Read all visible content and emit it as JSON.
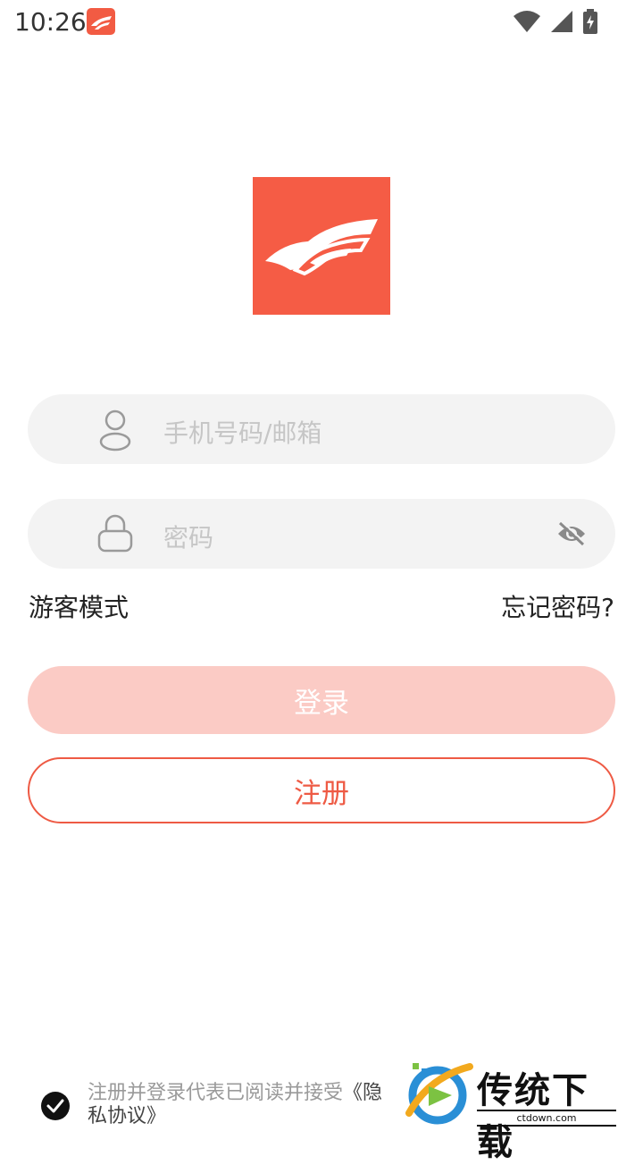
{
  "status_bar": {
    "time": "10:26",
    "icons": [
      "app-notification-icon",
      "wifi-icon",
      "cell-signal-icon",
      "battery-charging-icon"
    ]
  },
  "logo": {
    "icon": "brand-logo-icon",
    "color": "#f55c45"
  },
  "username_field": {
    "icon": "user-icon",
    "placeholder": "手机号码/邮箱",
    "value": ""
  },
  "password_field": {
    "icon": "lock-icon",
    "placeholder": "密码",
    "value": "",
    "toggle_icon": "eye-off-icon"
  },
  "links": {
    "guest_mode": "游客模式",
    "forgot_password": "忘记密码?"
  },
  "buttons": {
    "login": "登录",
    "register": "注册"
  },
  "agreement": {
    "prefix": "注册并登录代表已阅读并接受",
    "policy": "《隐私协议》",
    "checked": true
  },
  "watermark": {
    "title": "传统下载",
    "site": "ctdown.com"
  },
  "colors": {
    "accent": "#ee5a44",
    "login_disabled": "#fbcbc5",
    "input_bg": "#f3f3f3"
  }
}
